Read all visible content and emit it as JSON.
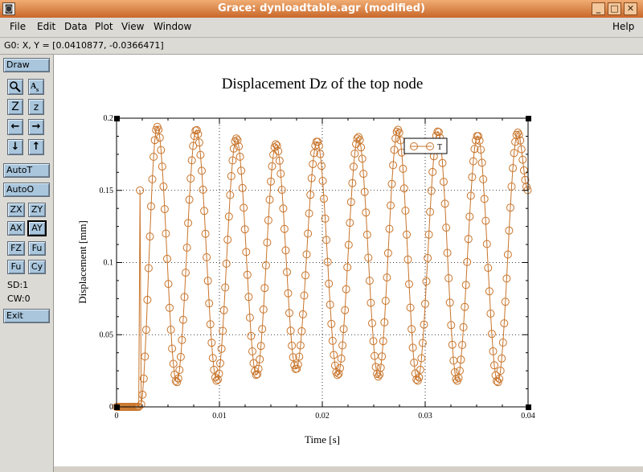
{
  "window": {
    "title": "Grace: dynloadtable.agr (modified)",
    "buttons": {
      "minimize": "_",
      "maximize": "□",
      "close": "✕"
    },
    "icon": "grace-app-icon"
  },
  "menu": {
    "items": [
      "File",
      "Edit",
      "Data",
      "Plot",
      "View",
      "Window"
    ],
    "help": "Help"
  },
  "status": {
    "coords": "G0: X, Y = [0.0410877, -0.0366471]"
  },
  "toolbar": {
    "draw": "Draw",
    "zoom_icon": "magnifier-icon",
    "autoscale_icon": "autoscale-icon",
    "z_big": "Z",
    "z_small": "z",
    "arrow_left": "←",
    "arrow_right": "→",
    "arrow_down": "↓",
    "arrow_up": "↑",
    "autot": "AutoT",
    "autoo": "AutoO",
    "zx": "ZX",
    "zy": "ZY",
    "ax": "AX",
    "ay": "AY",
    "fz": "FZ",
    "fu": "Fu",
    "fu2": "Fu",
    "cy": "Cy",
    "sd": "SD:1",
    "cw": "CW:0",
    "exit": "Exit"
  },
  "chart_data": {
    "type": "line",
    "title": "Displacement Dz of the top node",
    "xlabel": "Time [s]",
    "ylabel": "Displacement [mm]",
    "xlim": [
      0,
      0.04
    ],
    "ylim": [
      0,
      0.2
    ],
    "xticks": [
      "0",
      "0.01",
      "0.02",
      "0.03",
      "0.04"
    ],
    "yticks": [
      "0",
      "0.05",
      "0.1",
      "0.15",
      "0.2"
    ],
    "grid": true,
    "marker": "circle",
    "legend": {
      "position": "top-right",
      "entries": [
        "T"
      ]
    },
    "color": "#c8742a",
    "series": [
      {
        "name": "T",
        "sample_dt": 0.00012,
        "hold_until": 0.0022,
        "peaks": [
          [
            0.00395,
            0.194
          ],
          [
            0.00775,
            0.192
          ],
          [
            0.01165,
            0.186
          ],
          [
            0.0155,
            0.182
          ],
          [
            0.0195,
            0.184
          ],
          [
            0.0235,
            0.187
          ],
          [
            0.02735,
            0.192
          ],
          [
            0.03125,
            0.191
          ],
          [
            0.0351,
            0.188
          ],
          [
            0.039,
            0.19
          ]
        ],
        "troughs": [
          [
            0.0023,
            0.0
          ],
          [
            0.00585,
            0.017
          ],
          [
            0.00975,
            0.018
          ],
          [
            0.0136,
            0.022
          ],
          [
            0.01745,
            0.026
          ],
          [
            0.0215,
            0.022
          ],
          [
            0.02545,
            0.021
          ],
          [
            0.02925,
            0.018
          ],
          [
            0.0331,
            0.018
          ],
          [
            0.03705,
            0.017
          ],
          [
            0.04,
            0.15
          ]
        ]
      }
    ]
  }
}
